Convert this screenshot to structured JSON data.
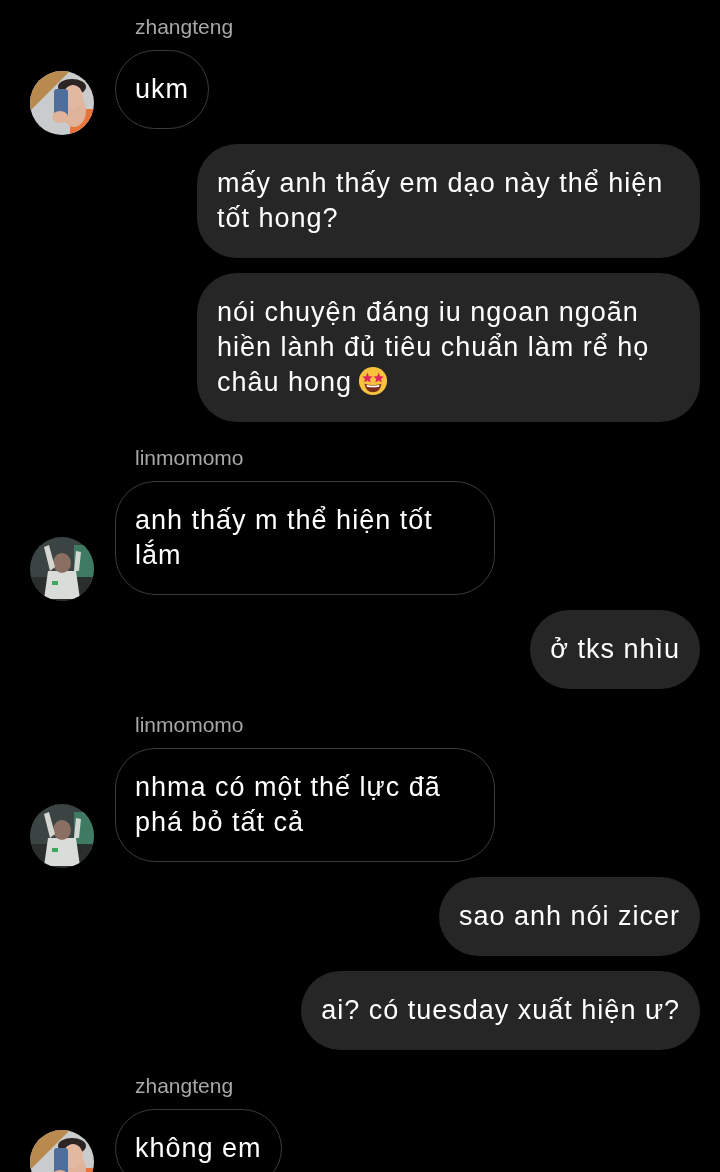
{
  "messages": [
    {
      "kind": "incoming",
      "sender": "zhangteng",
      "text": "ukm"
    },
    {
      "kind": "outgoing",
      "text": "mấy anh thấy em dạo này thể hiện tốt hong?"
    },
    {
      "kind": "outgoing",
      "text": "nói chuyện đáng iu ngoan ngoãn hiền lành đủ tiêu chuẩn làm rể họ châu hong",
      "emoji": true
    },
    {
      "kind": "incoming",
      "sender": "linmomomo",
      "text": "anh thấy m thể hiện tốt lắm"
    },
    {
      "kind": "outgoing",
      "text": "ở tks nhìu"
    },
    {
      "kind": "incoming",
      "sender": "linmomomo",
      "text": "nhma có một thế lực đã phá bỏ tất cả"
    },
    {
      "kind": "outgoing",
      "text": "sao anh nói zicer"
    },
    {
      "kind": "outgoing",
      "text": "ai? có tuesday xuất hiện ư?"
    },
    {
      "kind": "incoming",
      "sender": "zhangteng",
      "text": "không em"
    }
  ]
}
